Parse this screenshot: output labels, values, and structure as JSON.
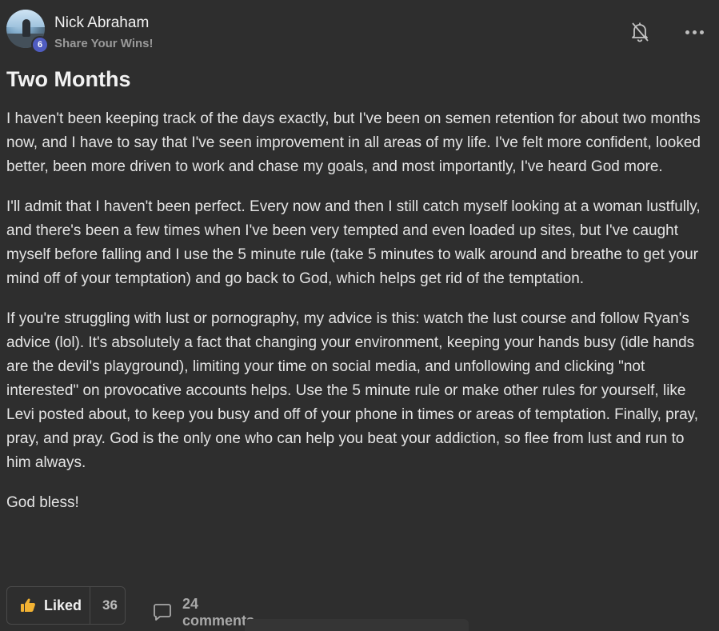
{
  "post": {
    "author": "Nick Abraham",
    "level": "6",
    "category": "Share Your Wins!",
    "title": "Two Months",
    "paragraphs": [
      "I haven't been keeping track of the days exactly, but I've been on semen retention for about two months now, and I have to say that I've seen improvement in all areas of my life. I've felt more confident, looked better, been more driven to work and chase my goals, and most importantly, I've heard God more.",
      "I'll admit that I haven't been perfect. Every now and then I still catch myself looking at a woman lustfully, and there's been a few times when I've been very tempted and even loaded up sites, but I've caught myself before falling and I use the 5 minute rule (take 5 minutes to walk around and breathe to get your mind off of your temptation) and go back to God, which helps get rid of the temptation.",
      "If you're struggling with lust or pornography, my advice is this: watch the lust course and follow Ryan's advice (lol). It's absolutely a fact that changing your environment, keeping your hands busy (idle hands are the devil's playground), limiting your time on social media, and unfollowing and clicking \"not interested\" on provocative accounts helps. Use the 5 minute rule or make other rules for yourself, like Levi posted about, to keep you busy and off of your phone in times or areas of temptation. Finally, pray, pray, and pray. God is the only one who can help you beat your addiction, so flee from lust and run to him always.",
      "God bless!"
    ],
    "actions": {
      "liked_label": "Liked",
      "like_count": "36",
      "comments_label": "24 comments"
    },
    "icons": {
      "bell": "bell-off-icon",
      "more": "more-horizontal-icon",
      "thumb": "thumbs-up-icon",
      "comment": "comment-icon"
    },
    "colors": {
      "background": "#2e2e2e",
      "badge": "#4f5cc0",
      "thumb": "#f2b233"
    }
  }
}
